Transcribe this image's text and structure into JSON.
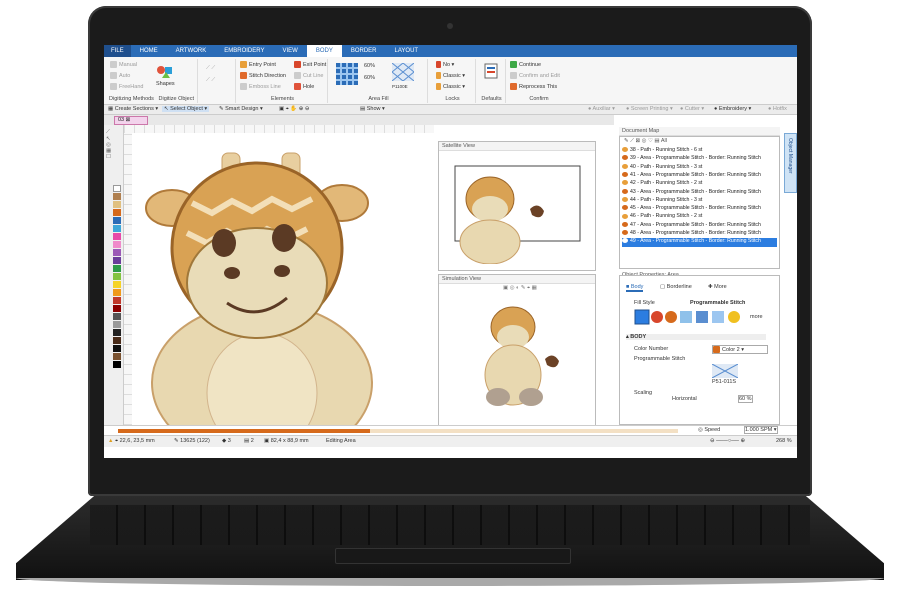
{
  "ribbon_tabs": [
    "FILE",
    "HOME",
    "ARTWORK",
    "EMBROIDERY",
    "VIEW",
    "BODY",
    "BORDER",
    "LAYOUT"
  ],
  "ribbon": {
    "digitizing_methods": {
      "items": [
        "Manual",
        "Auto",
        "FreeHand"
      ],
      "label": "Digitizing Methods"
    },
    "shapes": {
      "label": "Shapes",
      "group": "Digitize Object"
    },
    "elements": {
      "items": [
        "Entry Point",
        "Stitch Direction",
        "Emboss Line",
        "Exit Point",
        "Cut Line",
        "Hole"
      ],
      "label": "Elements"
    },
    "area_fill": {
      "v1": "60%",
      "v2": "60%",
      "pattern": "P1100E",
      "label": "Area Fill"
    },
    "locks": {
      "items": [
        "No",
        "Classic",
        "Classic"
      ],
      "label": "Locks"
    },
    "defaults": {
      "label": "Defaults"
    },
    "confirm": {
      "items": [
        "Continue",
        "Confirm and Edit",
        "Reprocess This"
      ],
      "label": "Confirm"
    }
  },
  "toolbar2": {
    "create_sections": "Create Sections",
    "select_object": "Select Object",
    "smart_design": "Smart Design",
    "show": "Show",
    "right": [
      "Auxiliar",
      "Screen Printing",
      "Cutter",
      "Embroidery",
      "Hotfix"
    ]
  },
  "doc_tab": "03",
  "satellite_view": "Satellite View",
  "simulation_view": "Simulation View",
  "document_map": {
    "title": "Document Map",
    "filter": "All",
    "rows": [
      "38 - Path - Running Stitch - 6 st",
      "39 - Area - Programmable Stitch - Border: Running Stitch",
      "40 - Path - Running Stitch - 3 st",
      "41 - Area - Programmable Stitch - Border: Running Stitch",
      "42 - Path - Running Stitch - 2 st",
      "43 - Area - Programmable Stitch - Border: Running Stitch",
      "44 - Path - Running Stitch - 3 st",
      "45 - Area - Programmable Stitch - Border: Running Stitch",
      "46 - Path - Running Stitch - 2 st",
      "47 - Area - Programmable Stitch - Border: Running Stitch",
      "48 - Area - Programmable Stitch - Border: Running Stitch",
      "49 - Area - Programmable Stitch - Border: Running Stitch"
    ]
  },
  "object_properties": {
    "title": "Object Properties: Area",
    "tabs": [
      "Body",
      "Borderline",
      "More"
    ],
    "fill_style": "Fill Style",
    "fill_name": "Programmable Stitch",
    "more": "more",
    "section": "BODY",
    "color_number_label": "Color Number",
    "color_value": "Color 2",
    "prog_stitch_label": "Programmable Stitch",
    "prog_code": "P51-011S",
    "scaling_label": "Scaling",
    "scaling_value": "60 %",
    "horizontal": "Horizontal"
  },
  "side_panel": "Object Manager",
  "playbar": {
    "speed_label": "Speed",
    "speed_value": "1.000 SPM"
  },
  "status": {
    "coords": "22,6, 23,5 mm",
    "stitches": "13625 (122)",
    "colors": "3",
    "objects": "2",
    "size": "82,4 x 88,9 mm",
    "mode": "Editing Area",
    "zoom": "268 %"
  },
  "colors": {
    "accent": "#2b6cb7",
    "selected": "#2c7de0",
    "giraffe": "#d9a254",
    "thread": "#c9782a"
  }
}
